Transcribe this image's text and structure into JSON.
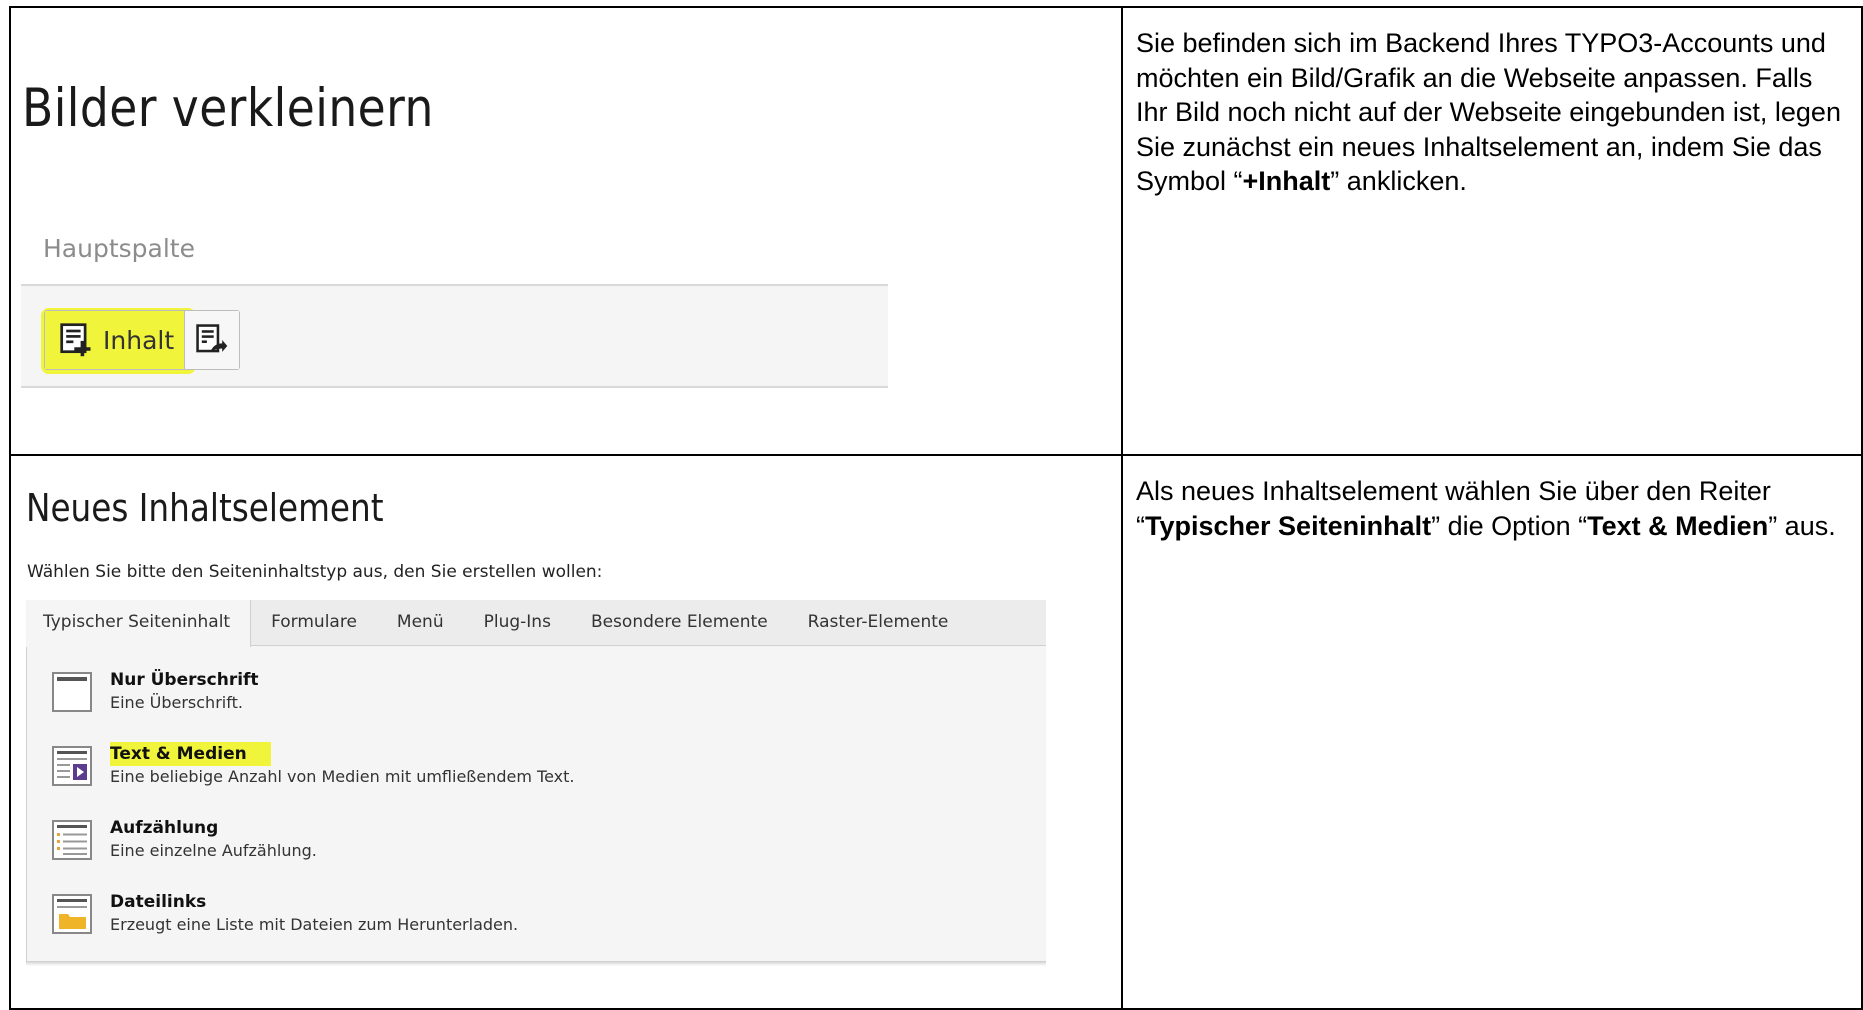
{
  "step1": {
    "screenshot": {
      "title": "Bilder verkleinern",
      "column_name": "Hauptspalte",
      "add_content_button": "Inhalt",
      "icons": [
        "add-content-icon",
        "paste-content-icon"
      ]
    },
    "description": {
      "part1": "Sie befinden sich im Backend Ihres TYPO3-Accounts und möchten ein Bild/Grafik an die Webseite anpassen. Falls Ihr Bild noch nicht auf der Webseite eingebunden ist, legen Sie zunächst ein neues Inhaltselement an, indem Sie das Symbol “",
      "bold1": "+Inhalt",
      "part2": "” anklicken."
    }
  },
  "step2": {
    "screenshot": {
      "title": "Neues Inhaltselement",
      "prompt": "Wählen Sie bitte den Seiteninhaltstyp aus, den Sie erstellen wollen:",
      "tabs": [
        "Typischer Seiteninhalt",
        "Formulare",
        "Menü",
        "Plug-Ins",
        "Besondere Elemente",
        "Raster-Elemente"
      ],
      "active_tab": "Typischer Seiteninhalt",
      "items": [
        {
          "title": "Nur Überschrift",
          "description": "Eine Überschrift.",
          "icon": "header-icon"
        },
        {
          "title": "Text & Medien",
          "description": "Eine beliebige Anzahl von Medien mit umfließendem Text.",
          "icon": "text-media-icon"
        },
        {
          "title": "Aufzählung",
          "description": "Eine einzelne Aufzählung.",
          "icon": "bullet-list-icon"
        },
        {
          "title": "Dateilinks",
          "description": "Erzeugt eine Liste mit Dateien zum Herunterladen.",
          "icon": "file-links-icon"
        }
      ],
      "highlight_color": "#f0f43a"
    },
    "description": {
      "part1": "Als neues Inhaltselement wählen Sie über den Reiter “",
      "bold1": "Typischer Seiteninhalt",
      "part2": "” die Option “",
      "bold2": "Text & Medien",
      "part3": "” aus."
    }
  }
}
